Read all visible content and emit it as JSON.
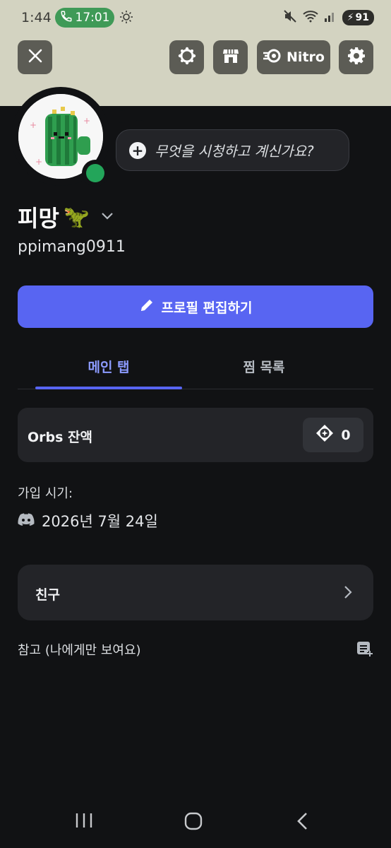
{
  "status_bar": {
    "time": "1:44",
    "call_time": "17:01",
    "battery": "91"
  },
  "top_buttons": {
    "nitro_label": "Nitro"
  },
  "profile": {
    "display_name": "피망",
    "display_emoji": "🦖",
    "username": "ppimang0911",
    "status_prompt": "무엇을 시청하고 계신가요?",
    "online_color": "#23a55a"
  },
  "edit_button": {
    "label": "프로필 편집하기"
  },
  "tabs": [
    {
      "label": "메인 탭",
      "active": true
    },
    {
      "label": "찜 목록",
      "active": false
    }
  ],
  "orbs": {
    "label": "Orbs 잔액",
    "value": "0"
  },
  "joined": {
    "label": "가입 시기:",
    "date": "2026년 7월 24일"
  },
  "friends": {
    "label": "친구"
  },
  "note": {
    "label": "참고 (나에게만 보여요)"
  },
  "colors": {
    "accent": "#5865f2",
    "banner": "#d3d3c1",
    "background": "#111214",
    "card": "#232428"
  }
}
